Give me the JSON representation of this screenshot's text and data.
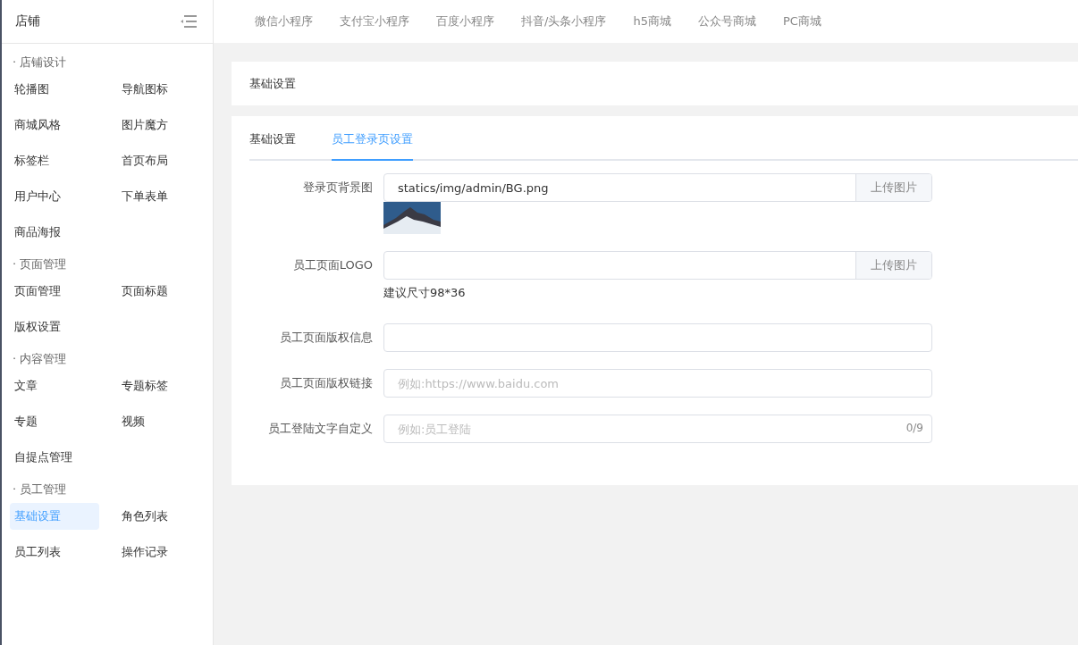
{
  "sidebar": {
    "title": "店铺",
    "groups": [
      {
        "title": "· 店铺设计",
        "items": [
          {
            "label": "轮播图",
            "selected": false
          },
          {
            "label": "导航图标",
            "selected": false
          },
          {
            "label": "商城风格",
            "selected": false
          },
          {
            "label": "图片魔方",
            "selected": false
          },
          {
            "label": "标签栏",
            "selected": false
          },
          {
            "label": "首页布局",
            "selected": false
          },
          {
            "label": "用户中心",
            "selected": false
          },
          {
            "label": "下单表单",
            "selected": false
          },
          {
            "label": "商品海报",
            "selected": false
          }
        ]
      },
      {
        "title": "· 页面管理",
        "items": [
          {
            "label": "页面管理",
            "selected": false
          },
          {
            "label": "页面标题",
            "selected": false
          },
          {
            "label": "版权设置",
            "selected": false
          }
        ]
      },
      {
        "title": "· 内容管理",
        "items": [
          {
            "label": "文章",
            "selected": false
          },
          {
            "label": "专题标签",
            "selected": false
          },
          {
            "label": "专题",
            "selected": false
          },
          {
            "label": "视频",
            "selected": false
          },
          {
            "label": "自提点管理",
            "selected": false
          }
        ]
      },
      {
        "title": "· 员工管理",
        "items": [
          {
            "label": "基础设置",
            "selected": true
          },
          {
            "label": "角色列表",
            "selected": false
          },
          {
            "label": "员工列表",
            "selected": false
          },
          {
            "label": "操作记录",
            "selected": false
          }
        ]
      }
    ]
  },
  "platform_tabs": [
    {
      "label": "微信小程序"
    },
    {
      "label": "支付宝小程序"
    },
    {
      "label": "百度小程序"
    },
    {
      "label": "抖音/头条小程序"
    },
    {
      "label": "h5商城"
    },
    {
      "label": "公众号商城"
    },
    {
      "label": "PC商城"
    }
  ],
  "section_title": "基础设置",
  "tabs": [
    {
      "label": "基础设置",
      "selected": false
    },
    {
      "label": "员工登录页设置",
      "selected": true
    }
  ],
  "form": [
    {
      "kind": "upload",
      "label": "登录页背景图",
      "value": "statics/img/admin/BG.png",
      "button": "上传图片",
      "has_preview": true
    },
    {
      "kind": "upload",
      "label": "员工页面LOGO",
      "button": "上传图片",
      "hint": "建议尺寸98*36"
    },
    {
      "kind": "text",
      "label": "员工页面版权信息"
    },
    {
      "kind": "text",
      "label": "员工页面版权链接",
      "placeholder": "例如:https://www.baidu.com"
    },
    {
      "kind": "counter",
      "label": "员工登陆文字自定义",
      "placeholder": "例如:员工登陆",
      "count": "0/9"
    }
  ]
}
